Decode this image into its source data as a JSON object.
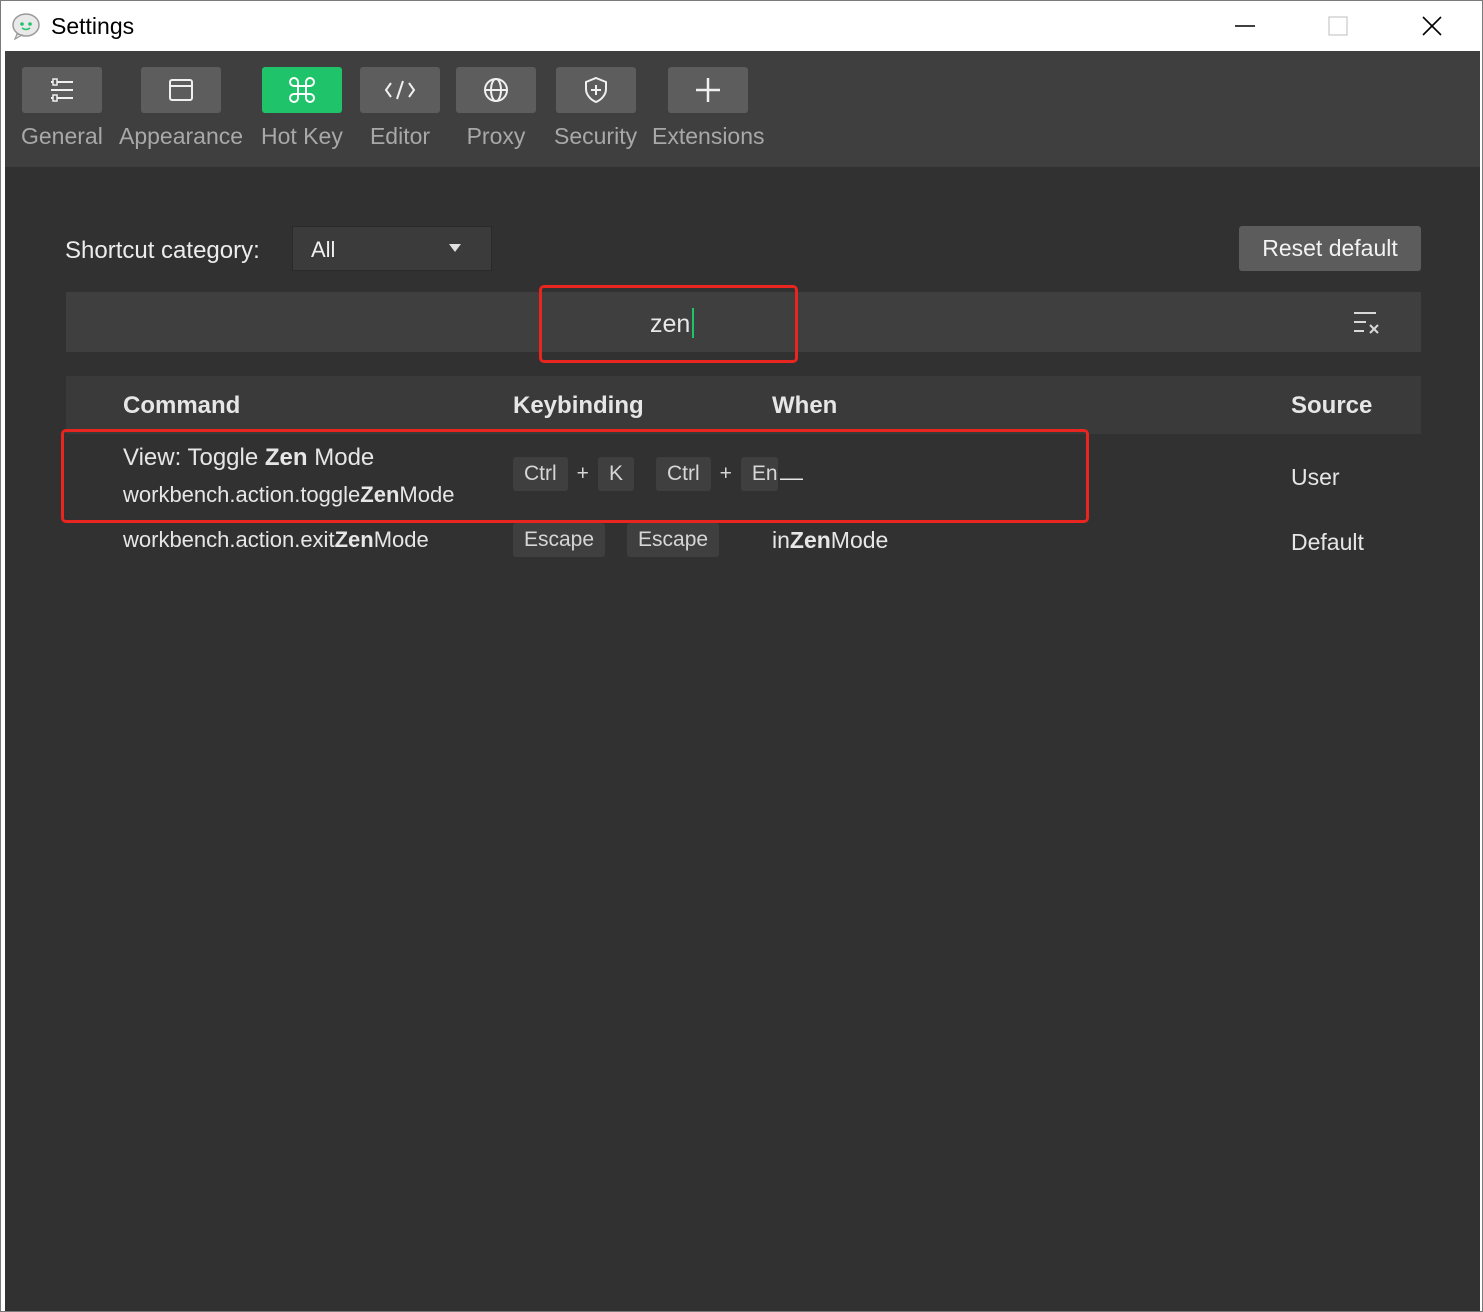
{
  "window": {
    "title": "Settings",
    "controls": [
      "minimize-icon",
      "maximize-icon",
      "close-icon"
    ]
  },
  "toolbar": {
    "items": [
      {
        "label": "General",
        "icon": "sliders-icon",
        "active": false
      },
      {
        "label": "Appearance",
        "icon": "window-icon",
        "active": false
      },
      {
        "label": "Hot Key",
        "icon": "command-key-icon",
        "active": true
      },
      {
        "label": "Editor",
        "icon": "code-icon",
        "active": false
      },
      {
        "label": "Proxy",
        "icon": "globe-icon",
        "active": false
      },
      {
        "label": "Security",
        "icon": "shield-icon",
        "active": false
      },
      {
        "label": "Extensions",
        "icon": "plus-icon",
        "active": false
      }
    ]
  },
  "filters": {
    "category_label": "Shortcut category:",
    "category_value": "All",
    "reset_label": "Reset default"
  },
  "search": {
    "value": "zen",
    "clear_icon": "clear-filter-icon"
  },
  "table": {
    "headers": {
      "command": "Command",
      "keybinding": "Keybinding",
      "when": "When",
      "source": "Source"
    },
    "rows": [
      {
        "title_pre": "View: Toggle ",
        "title_match": "Zen",
        "title_post": " Mode",
        "id_pre": "workbench.action.toggle",
        "id_match": "Zen",
        "id_post": "Mode",
        "chord1": [
          "Ctrl",
          "K"
        ],
        "chord2": [
          "Ctrl",
          "En"
        ],
        "when": "—",
        "source": "User"
      },
      {
        "id_pre": "workbench.action.exit",
        "id_match": "Zen",
        "id_post": "Mode",
        "key1": "Escape",
        "key2": "Escape",
        "when_pre": "in",
        "when_match": "Zen",
        "when_post": "Mode",
        "source": "Default"
      }
    ],
    "plus_sign": "+"
  },
  "colors": {
    "accent": "#1ec36a",
    "highlight_box": "#e8251e",
    "background": "#313131",
    "toolbar": "#3f3f3f"
  }
}
